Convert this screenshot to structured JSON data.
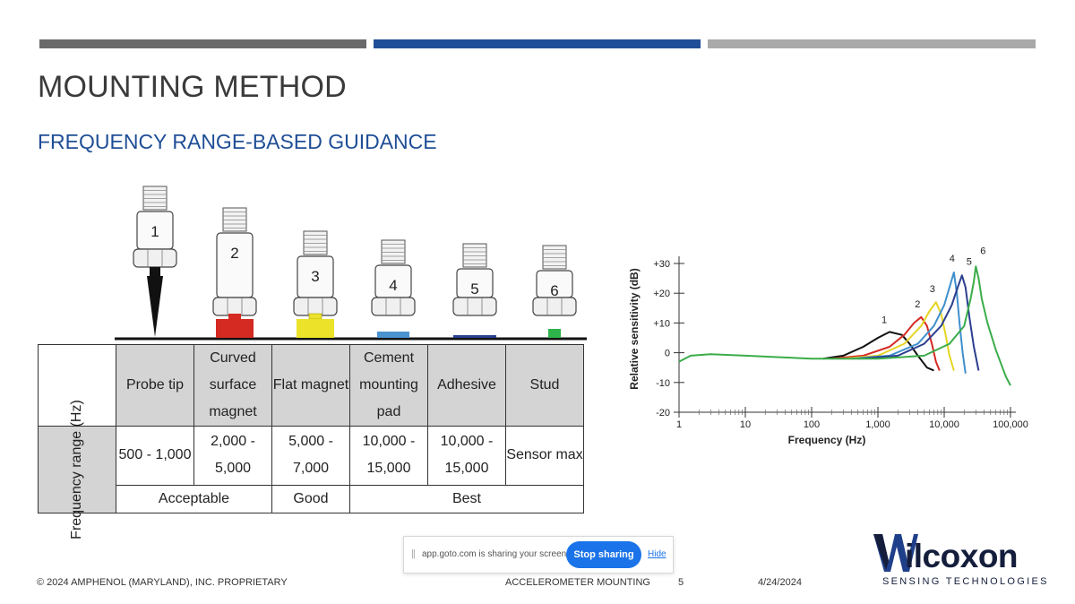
{
  "slide": {
    "title": "MOUNTING METHOD",
    "subtitle": "FREQUENCY RANGE-BASED GUIDANCE",
    "accent_colors": [
      "#6a6a6a",
      "#1f4e96",
      "#a9a9a9"
    ]
  },
  "sensors": {
    "labels": [
      "1",
      "2",
      "3",
      "4",
      "5",
      "6"
    ],
    "mount_colors": [
      "#111111",
      "#d42a22",
      "#ece22a",
      "#4a92d0",
      "#2b3f8f",
      "#2db34a"
    ]
  },
  "table": {
    "row_header": "Frequency range (Hz)",
    "methods": [
      "Probe tip",
      "Curved surface magnet",
      "Flat magnet",
      "Cement mounting pad",
      "Adhesive",
      "Stud"
    ],
    "ranges": [
      "500 - 1,000",
      "2,000 - 5,000",
      "5,000 - 7,000",
      "10,000 - 15,000",
      "10,000 - 15,000",
      "Sensor max"
    ],
    "ratings": [
      "Acceptable",
      "Good",
      "Best"
    ]
  },
  "chart_data": {
    "type": "line",
    "xlabel": "Frequency (Hz)",
    "ylabel": "Relative sensitivity (dB)",
    "xscale": "log",
    "xlim": [
      1,
      100000
    ],
    "ylim": [
      -20,
      30
    ],
    "x_ticks": [
      "1",
      "10",
      "100",
      "1,000",
      "10,000",
      "100,000"
    ],
    "y_ticks": [
      "+30",
      "+20",
      "+10",
      "0",
      "-10",
      "-20"
    ],
    "y_tick_values": [
      30,
      20,
      10,
      0,
      -10,
      -20
    ],
    "series": [
      {
        "name": "1",
        "color": "#111111",
        "points": [
          [
            150,
            -2
          ],
          [
            300,
            -1
          ],
          [
            600,
            2
          ],
          [
            1000,
            5
          ],
          [
            1500,
            7
          ],
          [
            2300,
            6
          ],
          [
            3000,
            3
          ],
          [
            4000,
            -1
          ],
          [
            5500,
            -5
          ],
          [
            7000,
            -6
          ]
        ]
      },
      {
        "name": "2",
        "color": "#d42a22",
        "points": [
          [
            200,
            -2
          ],
          [
            600,
            -1
          ],
          [
            1500,
            2
          ],
          [
            2500,
            6
          ],
          [
            3500,
            10
          ],
          [
            4500,
            12
          ],
          [
            5500,
            9
          ],
          [
            6500,
            3
          ],
          [
            7500,
            -3
          ],
          [
            8500,
            -6
          ]
        ]
      },
      {
        "name": "3",
        "color": "#e5d522",
        "points": [
          [
            300,
            -2
          ],
          [
            1000,
            -1
          ],
          [
            2500,
            3
          ],
          [
            4500,
            9
          ],
          [
            6000,
            14
          ],
          [
            7500,
            17
          ],
          [
            9000,
            13
          ],
          [
            10500,
            6
          ],
          [
            12000,
            -1
          ],
          [
            14000,
            -6
          ]
        ]
      },
      {
        "name": "4",
        "color": "#3f8fcc",
        "points": [
          [
            400,
            -2
          ],
          [
            1500,
            -1
          ],
          [
            4000,
            3
          ],
          [
            7000,
            9
          ],
          [
            10000,
            16
          ],
          [
            12000,
            22
          ],
          [
            14000,
            27
          ],
          [
            15500,
            20
          ],
          [
            17000,
            10
          ],
          [
            19000,
            0
          ],
          [
            21000,
            -7
          ]
        ]
      },
      {
        "name": "5",
        "color": "#2b3f8f",
        "points": [
          [
            500,
            -2
          ],
          [
            2000,
            -1
          ],
          [
            5000,
            3
          ],
          [
            9000,
            9
          ],
          [
            13000,
            16
          ],
          [
            16000,
            22
          ],
          [
            18500,
            26
          ],
          [
            21000,
            22
          ],
          [
            24000,
            12
          ],
          [
            28000,
            2
          ],
          [
            33000,
            -6
          ]
        ]
      },
      {
        "name": "6",
        "color": "#3aad4a",
        "points": [
          [
            1,
            -3
          ],
          [
            1.5,
            -1
          ],
          [
            3,
            -0.5
          ],
          [
            10,
            -1
          ],
          [
            100,
            -2
          ],
          [
            1000,
            -2
          ],
          [
            5000,
            -1
          ],
          [
            12000,
            3
          ],
          [
            20000,
            9
          ],
          [
            25000,
            18
          ],
          [
            28000,
            24
          ],
          [
            30000,
            29
          ],
          [
            33000,
            25
          ],
          [
            37000,
            18
          ],
          [
            45000,
            10
          ],
          [
            60000,
            1
          ],
          [
            85000,
            -8
          ],
          [
            100000,
            -11
          ]
        ]
      }
    ],
    "annotations": [
      "1",
      "2",
      "3",
      "4",
      "5",
      "6"
    ]
  },
  "screen_share": {
    "message": "app.goto.com is sharing your screen.",
    "stop_label": "Stop sharing",
    "hide_label": "Hide"
  },
  "footer": {
    "copyright": "© 2024 AMPHENOL (MARYLAND), INC. PROPRIETARY",
    "topic": "ACCELEROMETER MOUNTING",
    "page": "5",
    "date": "4/24/2024"
  },
  "logo": {
    "word": "ilcoxon",
    "tagline": "SENSING TECHNOLOGIES"
  }
}
